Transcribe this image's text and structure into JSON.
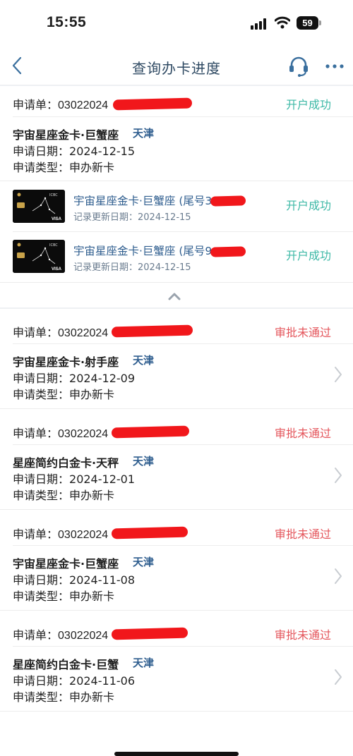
{
  "status_bar": {
    "time": "15:55",
    "battery": "59"
  },
  "nav": {
    "title": "查询办卡进度"
  },
  "labels": {
    "app_no": "申请单：",
    "date": "申请日期：",
    "type": "申请类型："
  },
  "first_app": {
    "no_prefix": "03022024",
    "status": "开户成功",
    "card_name": "宇宙星座金卡·巨蟹座",
    "city": "天津",
    "date": "2024-12-15",
    "type": "申办新卡",
    "cards": [
      {
        "title": "宇宙星座金卡·巨蟹座 (尾号3",
        "sub": "记录更新日期：2024-12-15",
        "status": "开户成功",
        "brand": "ICBC",
        "network": "VISA"
      },
      {
        "title": "宇宙星座金卡·巨蟹座 (尾号9",
        "sub": "记录更新日期：2024-12-15",
        "status": "开户成功",
        "brand": "ICBC",
        "network": "VISA"
      }
    ]
  },
  "applications": [
    {
      "no_prefix": "03022024",
      "status": "审批未通过",
      "card_name": "宇宙星座金卡·射手座",
      "city": "天津",
      "date": "2024-12-09",
      "type": "申办新卡"
    },
    {
      "no_prefix": "03022024",
      "status": "审批未通过",
      "card_name": "星座简约白金卡·天秤",
      "city": "天津",
      "date": "2024-12-01",
      "type": "申办新卡"
    },
    {
      "no_prefix": "03022024",
      "status": "审批未通过",
      "card_name": "宇宙星座金卡·巨蟹座",
      "city": "天津",
      "date": "2024-11-08",
      "type": "申办新卡"
    },
    {
      "no_prefix": "03022024",
      "status": "审批未通过",
      "card_name": "星座简约白金卡·巨蟹",
      "city": "天津",
      "date": "2024-11-06",
      "type": "申办新卡"
    }
  ],
  "colors": {
    "success": "#3cb8a6",
    "fail": "#e4555b",
    "title": "#2f4a63",
    "link": "#2f5e8f",
    "redaction": "#f10f14"
  },
  "icons": [
    "back-icon",
    "headset-icon",
    "more-icon",
    "chevron-up-icon",
    "chevron-right-icon",
    "signal-icon",
    "wifi-icon"
  ]
}
